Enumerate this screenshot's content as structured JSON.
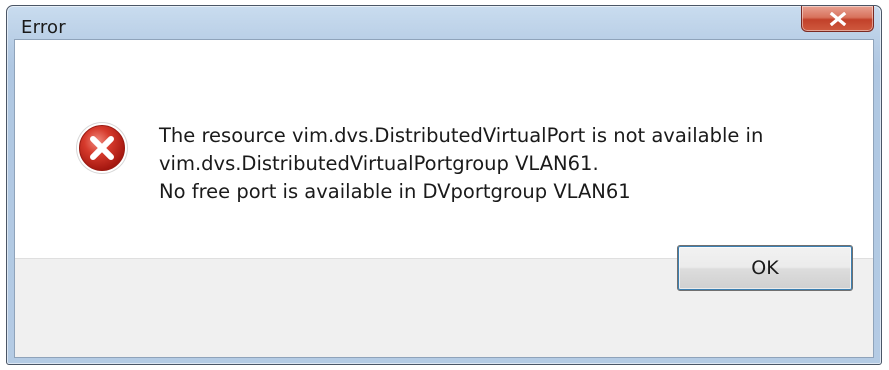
{
  "window": {
    "title": "Error",
    "close_icon": "close-icon"
  },
  "dialog": {
    "icon": "error-icon",
    "message_lines": [
      "The resource vim.dvs.DistributedVirtualPort is not available in",
      "vim.dvs.DistributedVirtualPortgroup VLAN61.",
      "No free port is available in DVportgroup VLAN61"
    ],
    "ok_label": "OK"
  },
  "colors": {
    "close_button": "#c84a31",
    "error_icon": "#c8281e",
    "title_bar": "#b7cde5"
  }
}
